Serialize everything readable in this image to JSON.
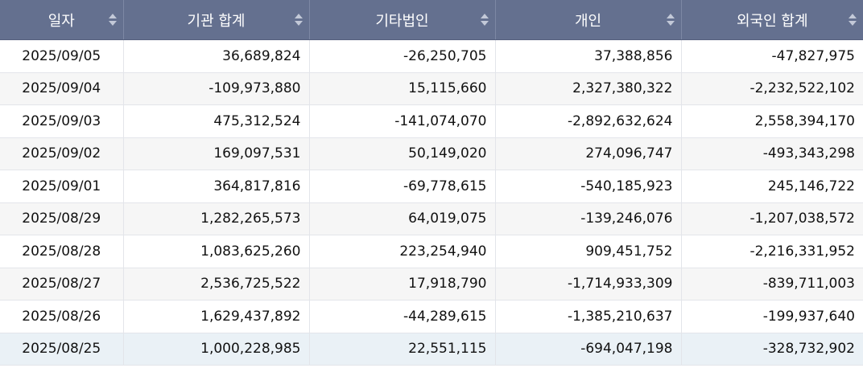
{
  "table": {
    "headers": [
      "일자",
      "기관 합계",
      "기타법인",
      "개인",
      "외국인 합계"
    ],
    "rows": [
      [
        "2025/09/05",
        "36,689,824",
        "-26,250,705",
        "37,388,856",
        "-47,827,975"
      ],
      [
        "2025/09/04",
        "-109,973,880",
        "15,115,660",
        "2,327,380,322",
        "-2,232,522,102"
      ],
      [
        "2025/09/03",
        "475,312,524",
        "-141,074,070",
        "-2,892,632,624",
        "2,558,394,170"
      ],
      [
        "2025/09/02",
        "169,097,531",
        "50,149,020",
        "274,096,747",
        "-493,343,298"
      ],
      [
        "2025/09/01",
        "364,817,816",
        "-69,778,615",
        "-540,185,923",
        "245,146,722"
      ],
      [
        "2025/08/29",
        "1,282,265,573",
        "64,019,075",
        "-139,246,076",
        "-1,207,038,572"
      ],
      [
        "2025/08/28",
        "1,083,625,260",
        "223,254,940",
        "909,451,752",
        "-2,216,331,952"
      ],
      [
        "2025/08/27",
        "2,536,725,522",
        "17,918,790",
        "-1,714,933,309",
        "-839,711,003"
      ],
      [
        "2025/08/26",
        "1,629,437,892",
        "-44,289,615",
        "-1,385,210,637",
        "-199,937,640"
      ],
      [
        "2025/08/25",
        "1,000,228,985",
        "22,551,115",
        "-694,047,198",
        "-328,732,902"
      ]
    ]
  },
  "icons": {
    "sort": "sort-icon"
  },
  "colors": {
    "header_bg": "#64708f",
    "highlight_row": "#eaf1f6",
    "even_row": "#f6f6f6"
  }
}
